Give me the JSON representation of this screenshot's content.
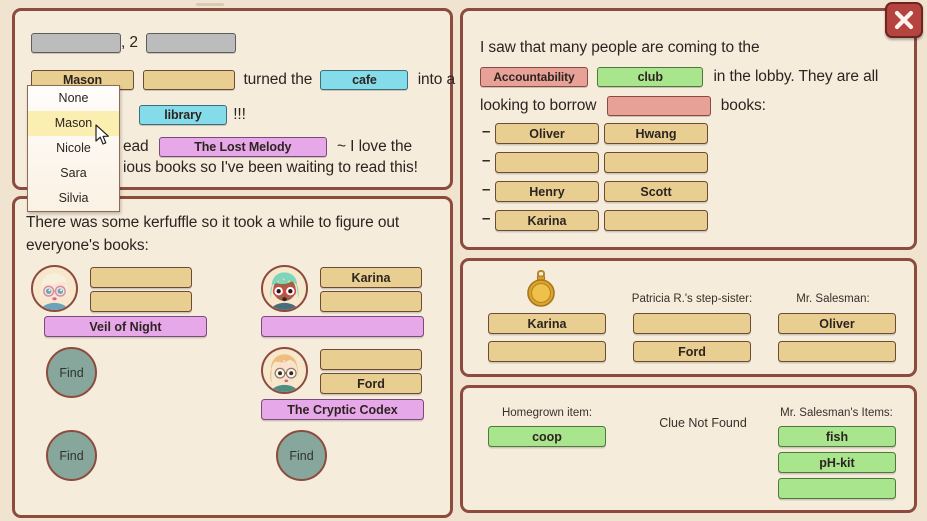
{
  "window": {
    "close_label": "close-icon"
  },
  "panel_story": {
    "blank_sep": ", 2",
    "line1_slots": [
      "",
      ""
    ],
    "line2": {
      "actor_chip": "Mason",
      "blank_chip": "",
      "text_turned": "turned the",
      "place_from": "cafe",
      "text_into": "into a"
    },
    "line3": {
      "place_to": "library",
      "exclaim": "!!!"
    },
    "line4": {
      "prefix": "ead",
      "book": "The Lost Melody",
      "suffix": "~ I love the"
    },
    "line5": "ious books so I've been waiting to read this!"
  },
  "dropdown": {
    "options": [
      "None",
      "Mason",
      "Nicole",
      "Sara",
      "Silvia"
    ],
    "selected": "Mason"
  },
  "panel_books": {
    "intro": "There was some kerfuffle so it took a while to figure out",
    "intro2": "everyone's books:",
    "entries": [
      {
        "avatar": "avatar-blonde-glasses",
        "name_top": "",
        "name_bottom": "",
        "book": "Veil of Night",
        "find_label": "Find"
      },
      {
        "avatar": "avatar-teal-hair-glasses",
        "name_top": "Karina",
        "name_bottom": "",
        "book": "",
        "find_label": "Find"
      },
      {
        "avatar": "",
        "name_top": "",
        "name_bottom": "",
        "book": "",
        "find_label": "Find"
      },
      {
        "avatar": "avatar-orange-hair-glasses",
        "name_top": "",
        "name_bottom": "Ford",
        "book": "The Cryptic Codex",
        "find_label": "Find"
      }
    ],
    "find_labels": [
      "Find",
      "Find",
      "Find"
    ]
  },
  "panel_lobby": {
    "text_a": "I saw that many people are coming to the",
    "chip_accountability": "Accountability",
    "chip_club": "club",
    "text_b": "in the lobby. They are all",
    "text_c": "looking to borrow",
    "chip_bookkind": "",
    "text_d": "books:",
    "people": [
      {
        "first": "Oliver",
        "last": "Hwang"
      },
      {
        "first": "",
        "last": ""
      },
      {
        "first": "Henry",
        "last": "Scott"
      },
      {
        "first": "Karina",
        "last": ""
      }
    ]
  },
  "panel_relations": {
    "watch_icon": "pocket-watch-icon",
    "col1": {
      "label": "",
      "values": [
        "Karina",
        ""
      ]
    },
    "col2": {
      "label": "Patricia R.'s step-sister:",
      "values": [
        "",
        "Ford"
      ]
    },
    "col3": {
      "label": "Mr. Salesman:",
      "values": [
        "Oliver",
        ""
      ]
    }
  },
  "panel_items": {
    "col1": {
      "label": "Homegrown item:",
      "values": [
        "coop"
      ]
    },
    "center_note": "Clue Not Found",
    "col3": {
      "label": "Mr. Salesman's Items:",
      "values": [
        "fish",
        "pH-kit",
        ""
      ]
    }
  },
  "colors": {
    "panel_bg": "#f6ecdc",
    "page_bg": "#f0e3d0",
    "panel_border": "#8d4b3d",
    "chip_tan": "#e8cf91",
    "chip_blue": "#84dbe9",
    "chip_purple": "#e6a8e8",
    "chip_pink": "#e8a197",
    "chip_green": "#a9e58c",
    "chip_gray": "#bcbcbc",
    "find_btn": "#87a79c",
    "close_btn": "#b5433f",
    "highlight": "#faeeb0"
  }
}
